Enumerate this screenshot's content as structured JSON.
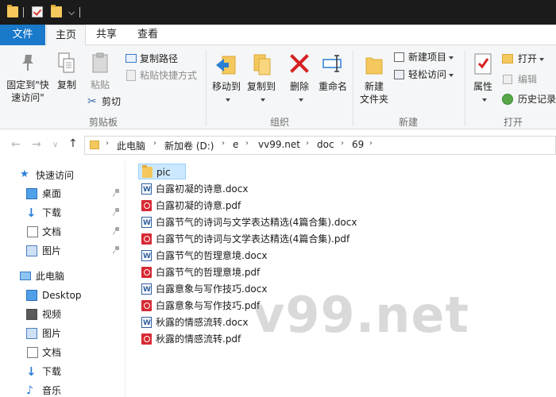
{
  "tabs": {
    "file": "文件",
    "home": "主页",
    "share": "共享",
    "view": "查看"
  },
  "ribbon": {
    "clipboard": {
      "pin_quick_access": [
        "固定到\"快",
        "速访问\""
      ],
      "copy": "复制",
      "paste": "粘贴",
      "copy_path": "复制路径",
      "paste_shortcut": "粘贴快捷方式",
      "cut": "剪切",
      "group_label": "剪贴板"
    },
    "organize": {
      "move_to": "移动到",
      "copy_to": "复制到",
      "delete": "删除",
      "rename": "重命名",
      "group_label": "组织"
    },
    "new": {
      "new_folder": [
        "新建",
        "文件夹"
      ],
      "new_item": "新建项目",
      "easy_access": "轻松访问",
      "group_label": "新建"
    },
    "open": {
      "properties": "属性",
      "open": "打开",
      "edit": "编辑",
      "history": "历史记录",
      "group_label": "打开"
    }
  },
  "address": {
    "crumbs": [
      "此电脑",
      "新加卷 (D:)",
      "e",
      "vv99.net",
      "doc",
      "69"
    ]
  },
  "navpane": {
    "items": [
      {
        "label": "快速访问",
        "icon": "star-icon",
        "pinned": false
      },
      {
        "label": "桌面",
        "icon": "desktop-icon",
        "pinned": true
      },
      {
        "label": "下载",
        "icon": "download-icon",
        "pinned": true
      },
      {
        "label": "文档",
        "icon": "documents-icon",
        "pinned": true
      },
      {
        "label": "图片",
        "icon": "pictures-icon",
        "pinned": true
      },
      {
        "label": "此电脑",
        "icon": "computer-icon",
        "pinned": false
      },
      {
        "label": "Desktop",
        "icon": "desktop-icon",
        "pinned": false
      },
      {
        "label": "视频",
        "icon": "video-icon",
        "pinned": false
      },
      {
        "label": "图片",
        "icon": "pictures-icon",
        "pinned": false
      },
      {
        "label": "文档",
        "icon": "documents-icon",
        "pinned": false
      },
      {
        "label": "下载",
        "icon": "download-icon",
        "pinned": false
      },
      {
        "label": "音乐",
        "icon": "music-icon",
        "pinned": false
      }
    ]
  },
  "files": [
    {
      "name": "pic",
      "type": "folder"
    },
    {
      "name": "白露初凝的诗意.docx",
      "type": "docx"
    },
    {
      "name": "白露初凝的诗意.pdf",
      "type": "pdf"
    },
    {
      "name": "白露节气的诗词与文学表达精选(4篇合集).docx",
      "type": "docx"
    },
    {
      "name": "白露节气的诗词与文学表达精选(4篇合集).pdf",
      "type": "pdf"
    },
    {
      "name": "白露节气的哲理意境.docx",
      "type": "docx"
    },
    {
      "name": "白露节气的哲理意境.pdf",
      "type": "pdf"
    },
    {
      "name": "白露意象与写作技巧.docx",
      "type": "docx"
    },
    {
      "name": "白露意象与写作技巧.pdf",
      "type": "pdf"
    },
    {
      "name": "秋露的情感流转.docx",
      "type": "docx"
    },
    {
      "name": "秋露的情感流转.pdf",
      "type": "pdf"
    }
  ],
  "watermark": "v99.net",
  "colors": {
    "file_tab": "#1979ca",
    "selection": "#cce8ff",
    "folder": "#f4c85c",
    "pdf": "#d62a34",
    "word": "#2f5f9f"
  }
}
